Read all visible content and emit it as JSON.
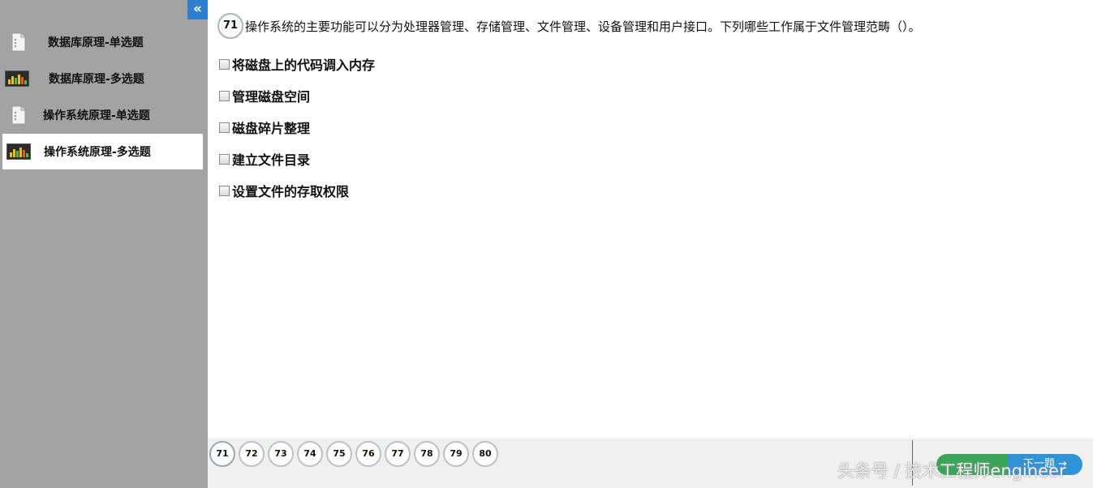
{
  "sidebar": {
    "collapse_glyph": "«",
    "items": [
      {
        "label": "数据库原理-单选题",
        "icon": "document-icon",
        "active": false
      },
      {
        "label": "数据库原理-多选题",
        "icon": "equalizer-icon",
        "active": false
      },
      {
        "label": "操作系统原理-单选题",
        "icon": "document-icon",
        "active": false
      },
      {
        "label": "操作系统原理-多选题",
        "icon": "equalizer-icon",
        "active": true
      }
    ]
  },
  "question": {
    "number": "71",
    "text": "操作系统的主要功能可以分为处理器管理、存储管理、文件管理、设备管理和用户接口。下列哪些工作属于文件管理范畴（）。",
    "options": [
      "将磁盘上的代码调入内存",
      "管理磁盘空间",
      "磁盘碎片整理",
      "建立文件目录",
      "设置文件的存取权限"
    ]
  },
  "pager": {
    "pages": [
      "71",
      "72",
      "73",
      "74",
      "75",
      "76",
      "77",
      "78",
      "79",
      "80"
    ],
    "current": "71"
  },
  "nav": {
    "prev_label": "",
    "next_label": "下一题 →"
  },
  "watermark": "头条号 / 技术工程师engineer",
  "colors": {
    "sidebar_bg": "#a3a3a3",
    "accent_blue": "#2f7fd1",
    "btn_green": "#3aa55a",
    "btn_blue": "#2f93d6"
  }
}
